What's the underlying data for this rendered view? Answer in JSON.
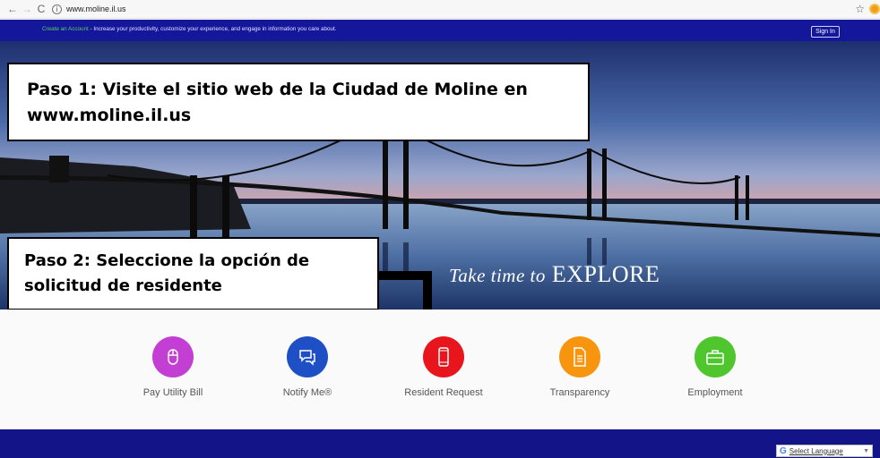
{
  "browser": {
    "url": "www.moline.il.us"
  },
  "topbar": {
    "create_link": "Create an Account",
    "message": " - Increase your productivity, customize your experience, and engage in information you care about.",
    "signin": "Sign In"
  },
  "hero": {
    "tagline_script": "Take time to",
    "tagline_main": "EXPLORE"
  },
  "callouts": {
    "step1": "Paso 1: Visite el sitio web de la Ciudad de Moline en www.moline.il.us",
    "step2": "Paso 2: Seleccione la opción de solicitud de residente"
  },
  "quick_links": [
    {
      "label": "Pay Utility Bill",
      "color": "#c33fd4",
      "icon": "mouse-icon"
    },
    {
      "label": "Notify Me®",
      "color": "#1f4fc4",
      "icon": "chat-bubbles-icon"
    },
    {
      "label": "Resident Request",
      "color": "#e8161c",
      "icon": "smartphone-icon"
    },
    {
      "label": "Transparency",
      "color": "#f7950f",
      "icon": "document-icon"
    },
    {
      "label": "Employment",
      "color": "#4fc52e",
      "icon": "briefcase-icon"
    }
  ],
  "footer": {
    "translate_label": "Select Language"
  }
}
